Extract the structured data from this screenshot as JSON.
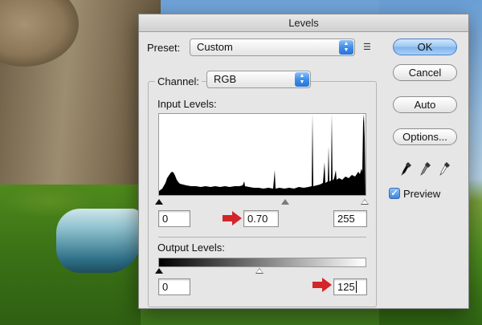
{
  "dialog": {
    "title": "Levels"
  },
  "preset": {
    "label": "Preset:",
    "value": "Custom"
  },
  "channel": {
    "label": "Channel:",
    "value": "RGB"
  },
  "input_levels": {
    "label": "Input Levels:",
    "black": "0",
    "gamma": "0.70",
    "white": "255"
  },
  "output_levels": {
    "label": "Output Levels:",
    "black": "0",
    "white": "125"
  },
  "buttons": {
    "ok": "OK",
    "cancel": "Cancel",
    "auto": "Auto",
    "options": "Options..."
  },
  "preview": {
    "label": "Preview",
    "checked": true
  },
  "icons": {
    "menu": "panel-menu-icon",
    "eyedropper_black": "black-eyedropper-icon",
    "eyedropper_gray": "gray-eyedropper-icon",
    "eyedropper_white": "white-eyedropper-icon",
    "annotation": "red-arrow-icon"
  },
  "colors": {
    "accent_blue": "#3f8ee9",
    "annotation_red": "#d3252a"
  }
}
